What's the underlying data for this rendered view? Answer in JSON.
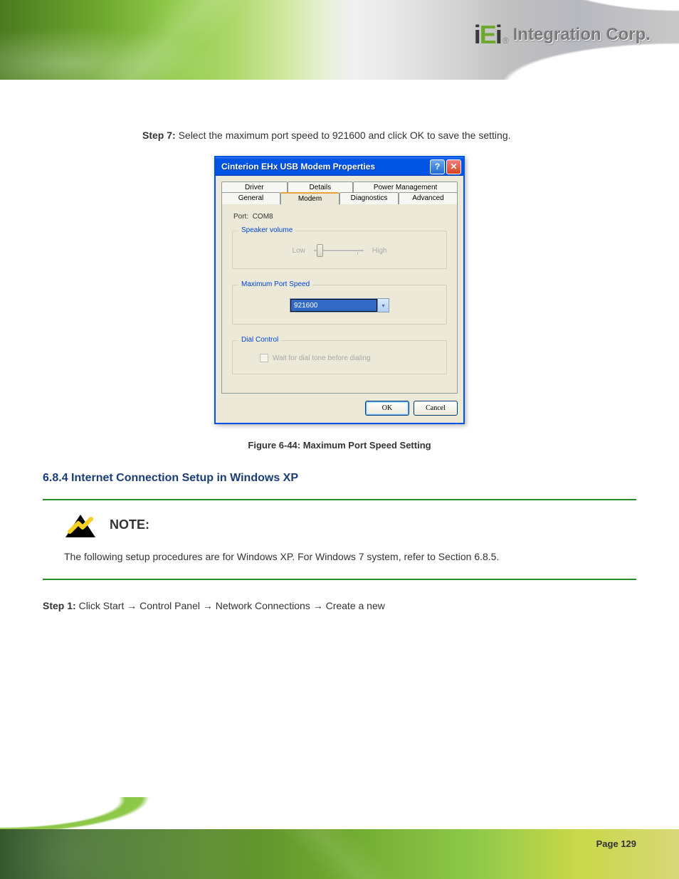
{
  "logo": {
    "company": "Integration Corp.",
    "mark_i1": "i",
    "mark_e": "E",
    "mark_i2": "i",
    "reg": "®"
  },
  "step_top": {
    "prefix": "Step 7:",
    "text": " Select the maximum port speed to 921600 and click OK to save the setting."
  },
  "dialog": {
    "title": "Cinterion EHx USB Modem Properties",
    "tabs_row0": [
      "Driver",
      "Details",
      "Power Management"
    ],
    "tabs_row1": [
      "General",
      "Modem",
      "Diagnostics",
      "Advanced"
    ],
    "port_label": "Port:",
    "port_value": "COM8",
    "groups": {
      "speaker": {
        "title": "Speaker volume",
        "low": "Low",
        "high": "High"
      },
      "maxspeed": {
        "title": "Maximum Port Speed",
        "value": "921600"
      },
      "dial": {
        "title": "Dial Control",
        "check": "Wait for dial tone before dialing"
      }
    },
    "ok": "OK",
    "cancel": "Cancel"
  },
  "figure_caption": "Figure 6-44: Maximum Port Speed Setting",
  "section_heading": "6.8.4 Internet Connection Setup in Windows XP",
  "note": {
    "label": "NOTE:",
    "text": "The following setup procedures are for Windows XP. For Windows 7 system, refer to Section 6.8.5."
  },
  "body_step": {
    "prefix": "Step 1:",
    "text": " Click Start → Control Panel → Network Connections → Create a new"
  },
  "page_num": "Page 129"
}
